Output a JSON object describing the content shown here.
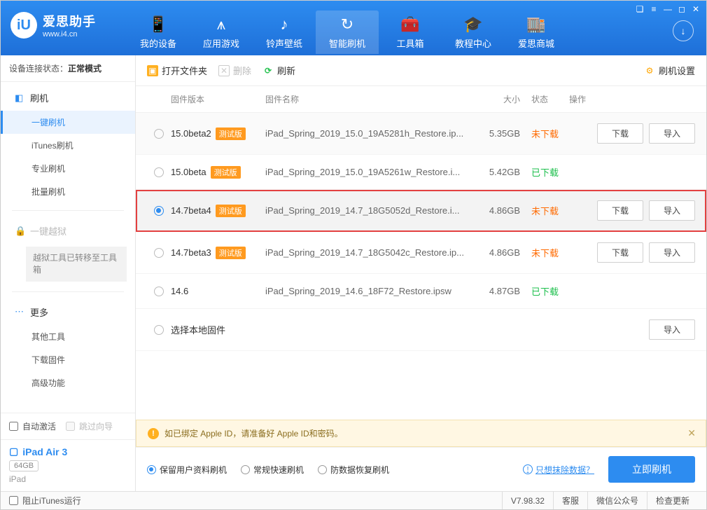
{
  "app": {
    "title": "爱思助手",
    "url": "www.i4.cn"
  },
  "winbtns": [
    "❏",
    "≡",
    "—",
    "◻",
    "✕"
  ],
  "nav": [
    {
      "label": "我的设备",
      "icon": "📱"
    },
    {
      "label": "应用游戏",
      "icon": "⩚"
    },
    {
      "label": "铃声壁纸",
      "icon": "♪"
    },
    {
      "label": "智能刷机",
      "icon": "↻",
      "active": true
    },
    {
      "label": "工具箱",
      "icon": "🧰"
    },
    {
      "label": "教程中心",
      "icon": "🎓"
    },
    {
      "label": "爱思商城",
      "icon": "🏬"
    }
  ],
  "sidebar": {
    "conn_label": "设备连接状态：",
    "conn_value": "正常模式",
    "flash_head": "刷机",
    "flash_items": [
      "一键刷机",
      "iTunes刷机",
      "专业刷机",
      "批量刷机"
    ],
    "jb_head": "一键越狱",
    "jb_note": "越狱工具已转移至工具箱",
    "more_head": "更多",
    "more_items": [
      "其他工具",
      "下载固件",
      "高级功能"
    ],
    "auto_activate": "自动激活",
    "skip_guide": "跳过向导",
    "device_name": "iPad Air 3",
    "device_cap": "64GB",
    "device_type": "iPad"
  },
  "toolbar": {
    "open": "打开文件夹",
    "delete": "删除",
    "refresh": "刷新",
    "settings": "刷机设置"
  },
  "thead": {
    "ver": "固件版本",
    "name": "固件名称",
    "size": "大小",
    "status": "状态",
    "ops": "操作"
  },
  "status_text": {
    "nd": "未下载",
    "dn": "已下载"
  },
  "btn_text": {
    "download": "下载",
    "import": "导入"
  },
  "beta_tag": "测试版",
  "rows": [
    {
      "ver": "15.0beta2",
      "beta": true,
      "name": "iPad_Spring_2019_15.0_19A5281h_Restore.ip...",
      "size": "5.35GB",
      "status": "nd",
      "ops": [
        "download",
        "import"
      ],
      "alt": true
    },
    {
      "ver": "15.0beta",
      "beta": true,
      "name": "iPad_Spring_2019_15.0_19A5261w_Restore.i...",
      "size": "5.42GB",
      "status": "dn",
      "ops": []
    },
    {
      "ver": "14.7beta4",
      "beta": true,
      "name": "iPad_Spring_2019_14.7_18G5052d_Restore.i...",
      "size": "4.86GB",
      "status": "nd",
      "ops": [
        "download",
        "import"
      ],
      "selected": true,
      "hl": true
    },
    {
      "ver": "14.7beta3",
      "beta": true,
      "name": "iPad_Spring_2019_14.7_18G5042c_Restore.ip...",
      "size": "4.86GB",
      "status": "nd",
      "ops": [
        "download",
        "import"
      ]
    },
    {
      "ver": "14.6",
      "beta": false,
      "name": "iPad_Spring_2019_14.6_18F72_Restore.ipsw",
      "size": "4.87GB",
      "status": "dn",
      "ops": []
    }
  ],
  "local_row": "选择本地固件",
  "notice": "如已绑定 Apple ID，请准备好 Apple ID和密码。",
  "modes": [
    {
      "label": "保留用户资料刷机",
      "on": true
    },
    {
      "label": "常规快速刷机",
      "on": false
    },
    {
      "label": "防数据恢复刷机",
      "on": false
    }
  ],
  "erase_link": "只想抹除数据？",
  "flash_btn": "立即刷机",
  "statusbar": {
    "block_itunes": "阻止iTunes运行",
    "version": "V7.98.32",
    "kefu": "客服",
    "wechat": "微信公众号",
    "update": "检查更新"
  }
}
